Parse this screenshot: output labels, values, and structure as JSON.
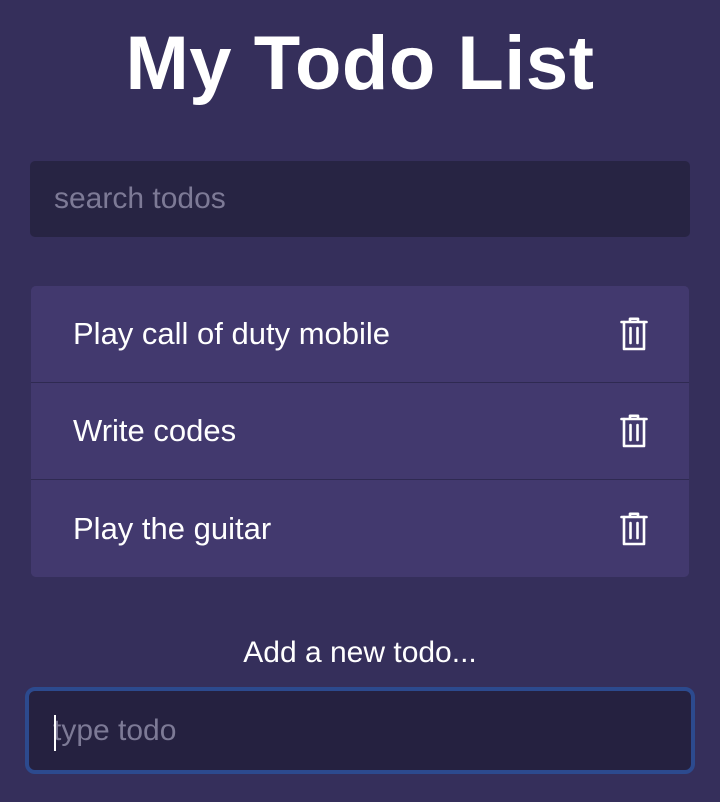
{
  "header": {
    "title": "My Todo List"
  },
  "search": {
    "placeholder": "search todos",
    "value": ""
  },
  "todos": [
    {
      "text": "Play call of duty mobile",
      "delete_icon": "trash-icon"
    },
    {
      "text": "Write codes",
      "delete_icon": "trash-icon"
    },
    {
      "text": "Play the guitar",
      "delete_icon": "trash-icon"
    }
  ],
  "add": {
    "label": "Add a new todo...",
    "placeholder": "type todo",
    "value": ""
  },
  "colors": {
    "background": "#352f5b",
    "list_item": "#42396e",
    "input_background": "#272443",
    "focus_border": "#2c4a8e",
    "placeholder": "#7d7a96",
    "text": "#ffffff"
  }
}
